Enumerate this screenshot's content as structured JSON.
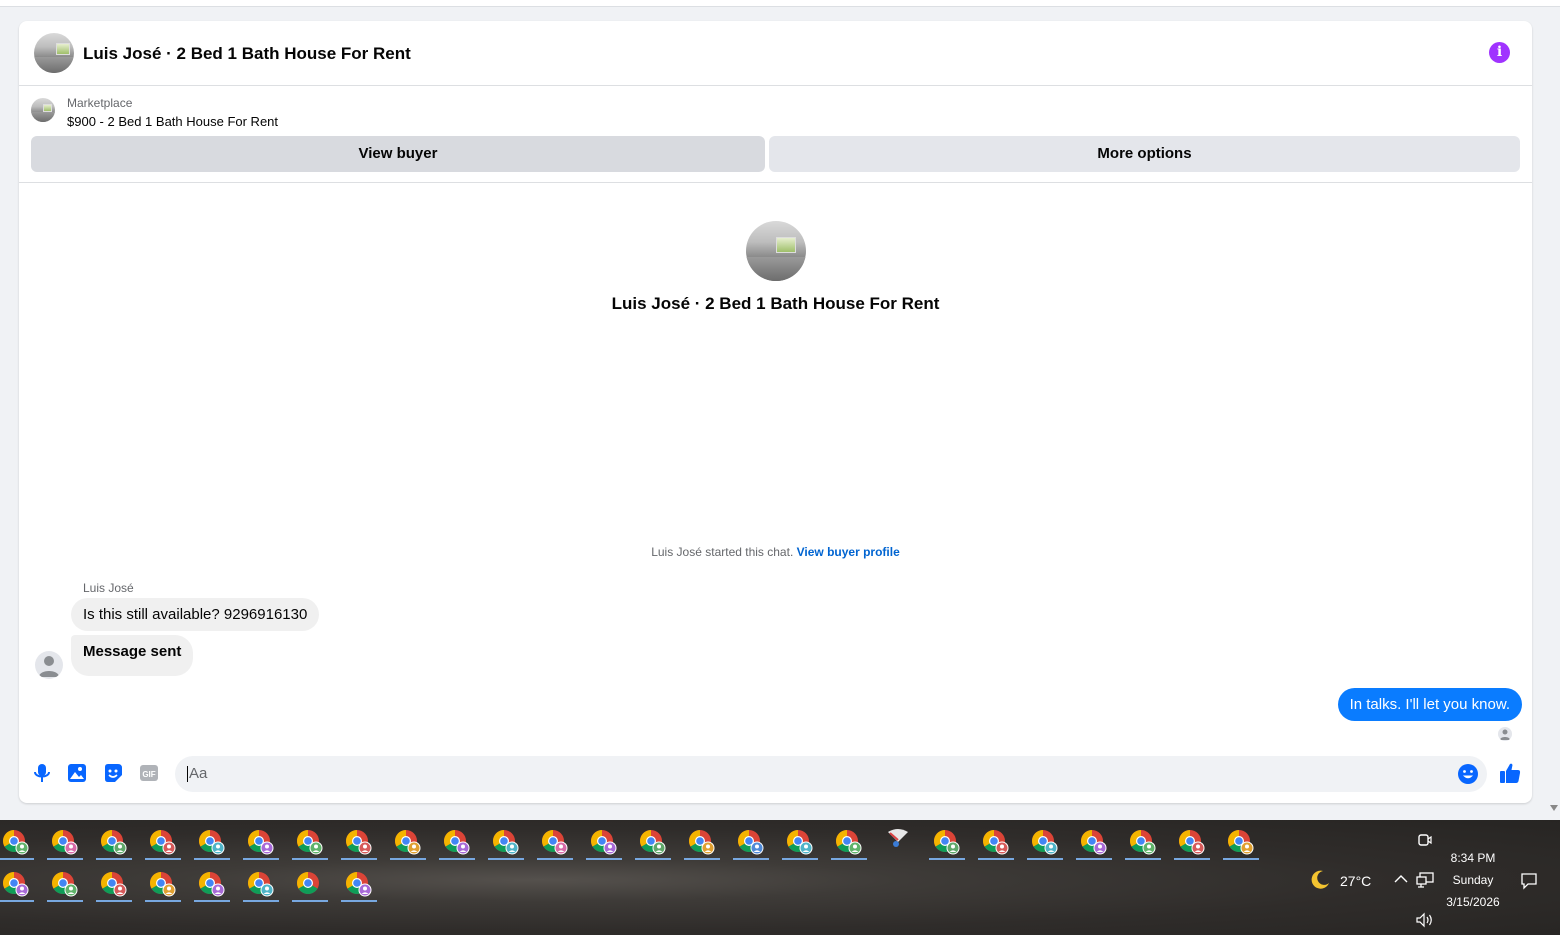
{
  "conversation": {
    "title": "Luis José · 2 Bed 1 Bath House For Rent",
    "info_icon": "info-icon",
    "accent_color": "#a033ff"
  },
  "listing": {
    "category": "Marketplace",
    "name": "$900 - 2 Bed 1 Bath House For Rent",
    "view_buyer_label": "View buyer",
    "more_options_label": "More options"
  },
  "chat_intro": {
    "title": "Luis José · 2 Bed 1 Bath House For Rent",
    "started_text": "Luis José started this chat.",
    "profile_link": "View buyer profile"
  },
  "messages": {
    "sender_name": "Luis José",
    "incoming": [
      "Is this still available? 9296916130",
      "Message sent"
    ],
    "outgoing": [
      "In talks. I'll let you know."
    ],
    "outgoing_color": "#0a7cff"
  },
  "composer": {
    "placeholder": "Aa",
    "icons": [
      "microphone-icon",
      "photo-icon",
      "sticker-icon",
      "gif-icon",
      "emoji-icon",
      "thumbs-up-icon"
    ],
    "gif_label": "GIF"
  },
  "taskbar": {
    "temperature": "27°C",
    "weather_icon": "moon-icon",
    "time": "8:34 PM",
    "day": "Sunday",
    "date": "3/15/2026"
  }
}
